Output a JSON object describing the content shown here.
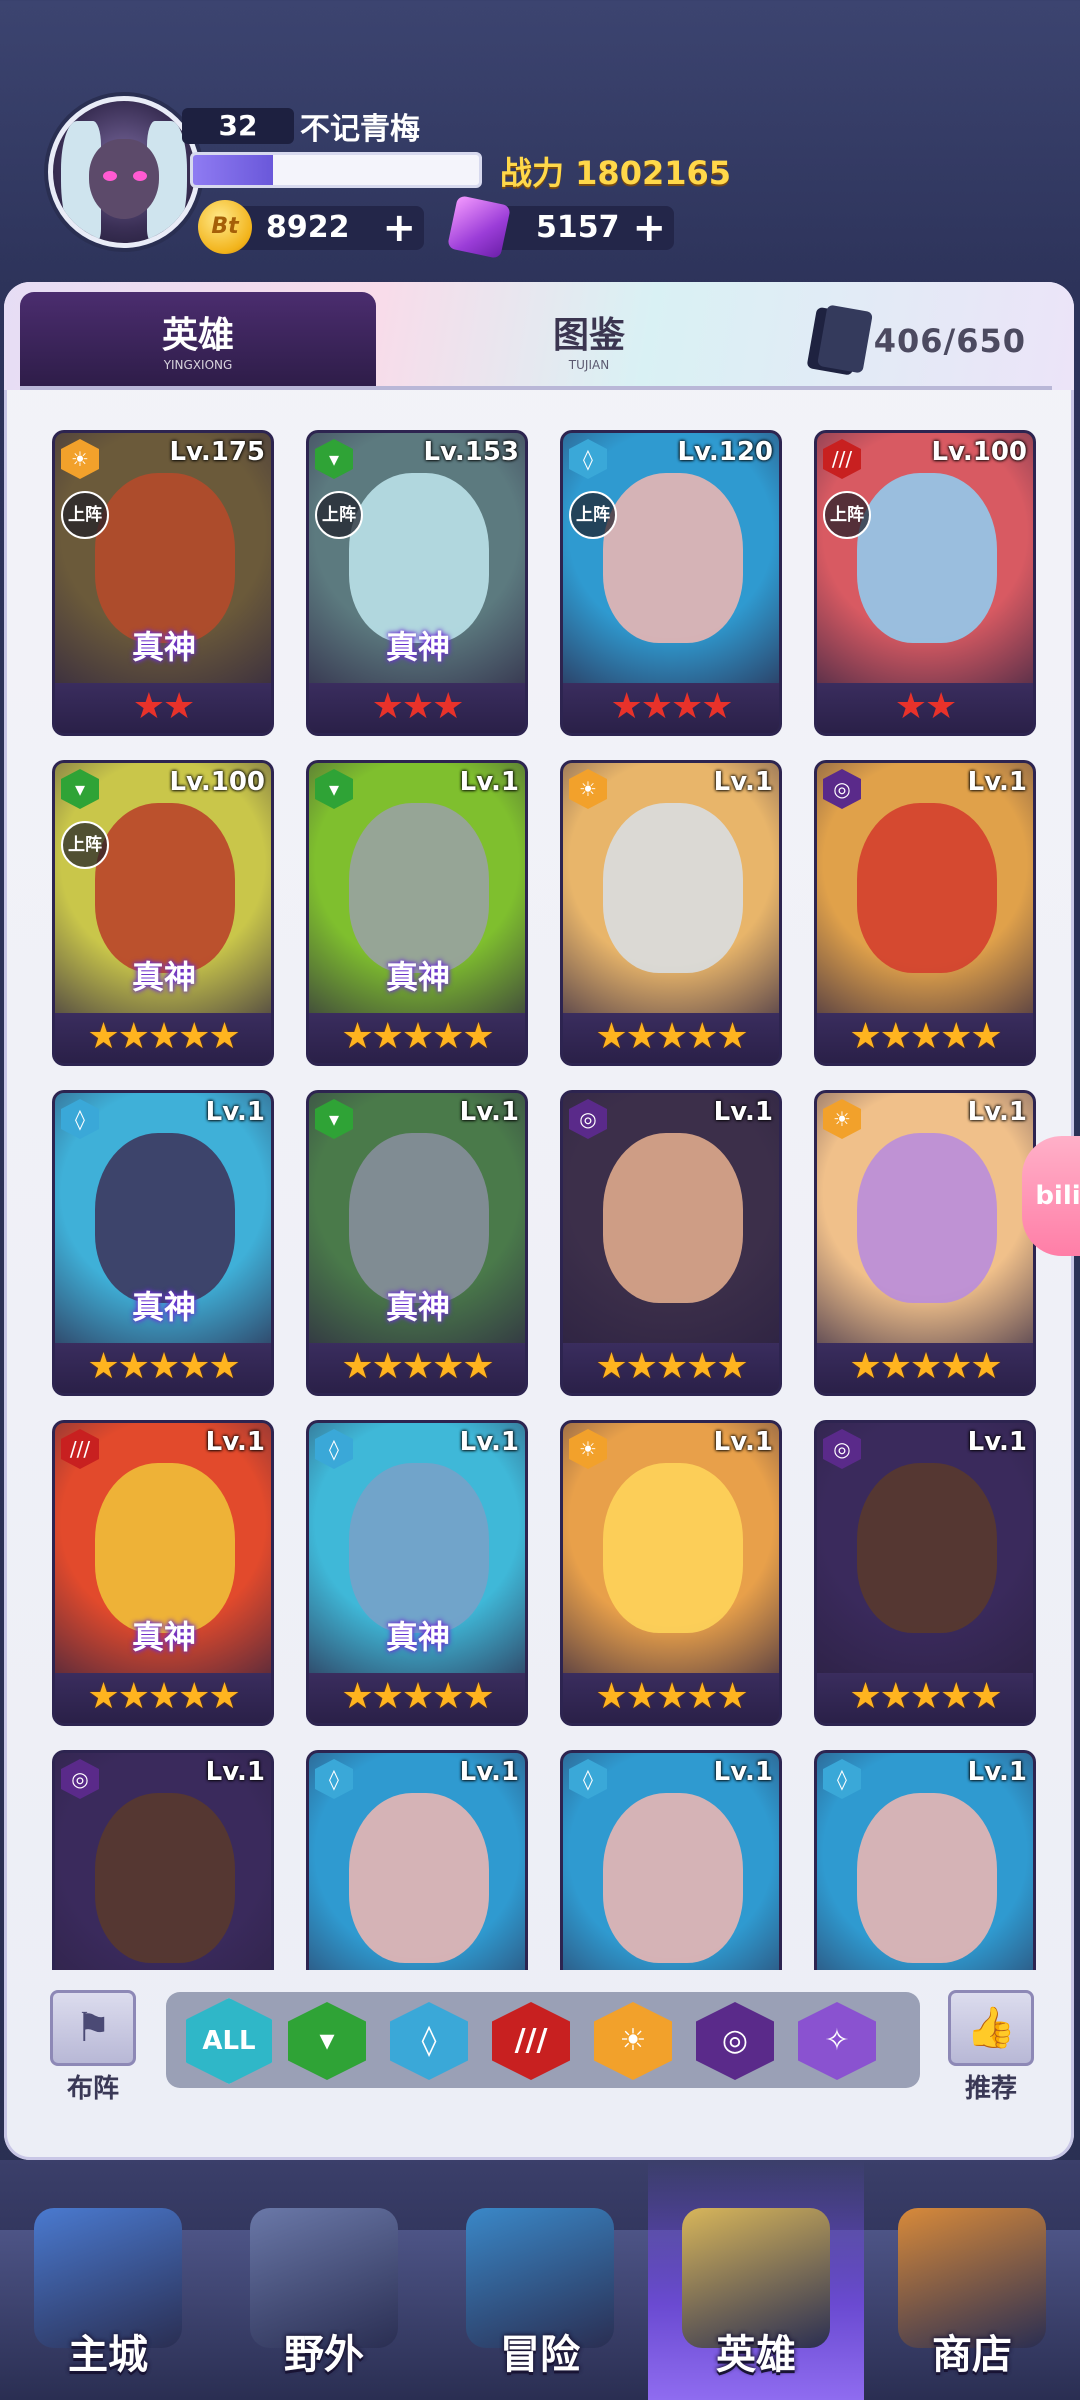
{
  "player": {
    "level": "32",
    "name": "不记青梅",
    "exp_progress": 0.28,
    "power_label": "战力",
    "power_value": "1802165",
    "coins": "8922",
    "coin_icon_text": "Bt",
    "gems": "5157",
    "plus": "+"
  },
  "tabs": {
    "hero": {
      "label": "英雄",
      "sub": "YINGXIONG"
    },
    "atlas": {
      "label": "图鉴",
      "sub": "TUJIAN"
    },
    "card_count": "406/650"
  },
  "cards": [
    {
      "level": "Lv.175",
      "element": "sun",
      "elem_color": "#f2a12b",
      "stars": "★★",
      "star_color": "red",
      "deployed": true,
      "god": true,
      "bg": "#6b5a3a",
      "char": "#b84a2a"
    },
    {
      "level": "Lv.153",
      "element": "leaf",
      "elem_color": "#2fa336",
      "stars": "★★★",
      "star_color": "red",
      "deployed": true,
      "god": true,
      "bg": "#5c7a7f",
      "char": "#bfe7ee"
    },
    {
      "level": "Lv.120",
      "element": "water",
      "elem_color": "#3aa8d8",
      "stars": "★★★★",
      "star_color": "red",
      "deployed": true,
      "god": false,
      "bg": "#2f9ad0",
      "char": "#f2b7b2"
    },
    {
      "level": "Lv.100",
      "element": "claw",
      "elem_color": "#c82020",
      "stars": "★★",
      "star_color": "red",
      "deployed": true,
      "god": false,
      "bg": "#d85a62",
      "char": "#8fd0f4"
    },
    {
      "level": "Lv.100",
      "element": "leaf",
      "elem_color": "#2fa336",
      "stars": "★★★★★",
      "star_color": "gold",
      "deployed": true,
      "god": true,
      "bg": "#c9c64a",
      "char": "#b83c28"
    },
    {
      "level": "Lv.1",
      "element": "leaf",
      "elem_color": "#2fa336",
      "stars": "★★★★★",
      "star_color": "gold",
      "deployed": false,
      "god": true,
      "bg": "#7fbf2e",
      "char": "#9aa0a8"
    },
    {
      "level": "Lv.1",
      "element": "sun",
      "elem_color": "#f2a12b",
      "stars": "★★★★★",
      "star_color": "gold",
      "deployed": false,
      "god": false,
      "bg": "#e8b56a",
      "char": "#d8dfe6"
    },
    {
      "level": "Lv.1",
      "element": "void",
      "elem_color": "#5a2a8a",
      "stars": "★★★★★",
      "star_color": "gold",
      "deployed": false,
      "god": false,
      "bg": "#e0a14a",
      "char": "#d23a2c"
    },
    {
      "level": "Lv.1",
      "element": "water",
      "elem_color": "#3aa8d8",
      "stars": "★★★★★",
      "star_color": "gold",
      "deployed": false,
      "god": true,
      "bg": "#3fb0d8",
      "char": "#3d3158"
    },
    {
      "level": "Lv.1",
      "element": "leaf",
      "elem_color": "#2fa336",
      "stars": "★★★★★",
      "star_color": "gold",
      "deployed": false,
      "god": true,
      "bg": "#4a7a4a",
      "char": "#8a8fa0"
    },
    {
      "level": "Lv.1",
      "element": "void",
      "elem_color": "#5a2a8a",
      "stars": "★★★★★",
      "star_color": "gold",
      "deployed": false,
      "god": false,
      "bg": "#3c2f4a",
      "char": "#e8b08f"
    },
    {
      "level": "Lv.1",
      "element": "sun",
      "elem_color": "#f2a12b",
      "stars": "★★★★★",
      "star_color": "gold",
      "deployed": false,
      "god": false,
      "bg": "#f0c08a",
      "char": "#b68ae0"
    },
    {
      "level": "Lv.1",
      "element": "claw",
      "elem_color": "#c82020",
      "stars": "★★★★★",
      "star_color": "gold",
      "deployed": false,
      "god": true,
      "bg": "#e24a2c",
      "char": "#f0c43a"
    },
    {
      "level": "Lv.1",
      "element": "water",
      "elem_color": "#3aa8d8",
      "stars": "★★★★★",
      "star_color": "gold",
      "deployed": false,
      "god": true,
      "bg": "#3fb8d8",
      "char": "#7aa0c8"
    },
    {
      "level": "Lv.1",
      "element": "sun",
      "elem_color": "#f2a12b",
      "stars": "★★★★★",
      "star_color": "gold",
      "deployed": false,
      "god": false,
      "bg": "#e8a04a",
      "char": "#ffd65a"
    },
    {
      "level": "Lv.1",
      "element": "void",
      "elem_color": "#5a2a8a",
      "stars": "★★★★★",
      "star_color": "gold",
      "deployed": false,
      "god": false,
      "bg": "#3a2a5c",
      "char": "#5a3a2a"
    },
    {
      "level": "Lv.1",
      "element": "void",
      "elem_color": "#5a2a8a",
      "stars": "",
      "star_color": "gold",
      "deployed": false,
      "god": false,
      "bg": "#3a2a5c",
      "char": "#5a3a2a"
    },
    {
      "level": "Lv.1",
      "element": "water",
      "elem_color": "#3aa8d8",
      "stars": "",
      "star_color": "gold",
      "deployed": false,
      "god": false,
      "bg": "#2f9ad0",
      "char": "#f2b7b2"
    },
    {
      "level": "Lv.1",
      "element": "water",
      "elem_color": "#3aa8d8",
      "stars": "",
      "star_color": "gold",
      "deployed": false,
      "god": false,
      "bg": "#2f9ad0",
      "char": "#f2b7b2"
    },
    {
      "level": "Lv.1",
      "element": "water",
      "elem_color": "#3aa8d8",
      "stars": "",
      "star_color": "gold",
      "deployed": false,
      "god": false,
      "bg": "#2f9ad0",
      "char": "#f2b7b2"
    }
  ],
  "card_labels": {
    "deploy": "上阵",
    "god": "真神"
  },
  "filters": {
    "left_label": "布阵",
    "right_label": "推荐",
    "buttons": [
      {
        "name": "all",
        "text": "ALL",
        "color": "#2fb7c8"
      },
      {
        "name": "leaf",
        "text": "▾",
        "color": "#2fa336"
      },
      {
        "name": "water",
        "text": "◊",
        "color": "#3aa8d8"
      },
      {
        "name": "claw",
        "text": "///",
        "color": "#c82020"
      },
      {
        "name": "sun",
        "text": "☀",
        "color": "#f2a12b"
      },
      {
        "name": "void",
        "text": "◎",
        "color": "#5a2a8a"
      },
      {
        "name": "star",
        "text": "✧",
        "color": "#8a52d0"
      }
    ]
  },
  "nav": [
    {
      "label": "主城",
      "name": "nav-main-city",
      "color": "#4a7ad0"
    },
    {
      "label": "野外",
      "name": "nav-wild",
      "color": "#6a78a8"
    },
    {
      "label": "冒险",
      "name": "nav-adventure",
      "color": "#3a88c8"
    },
    {
      "label": "英雄",
      "name": "nav-hero",
      "color": "#d8b65a",
      "active": true
    },
    {
      "label": "商店",
      "name": "nav-shop",
      "color": "#d88a3a"
    }
  ],
  "edge_badge": "bili"
}
